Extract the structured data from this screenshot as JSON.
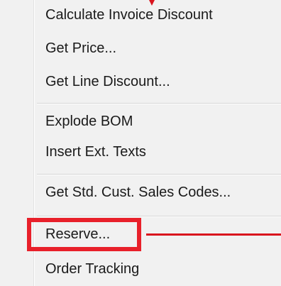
{
  "context_menu": {
    "items": [
      {
        "label": "Calculate Invoice Discount"
      },
      {
        "label": "Get Price..."
      },
      {
        "label": "Get Line Discount..."
      },
      {
        "label": "Explode BOM"
      },
      {
        "label": "Insert Ext. Texts"
      },
      {
        "label": "Get Std. Cust. Sales Codes..."
      },
      {
        "label": "Reserve..."
      },
      {
        "label": "Order Tracking"
      }
    ],
    "highlighted_item": "Reserve..."
  },
  "annotation": {
    "color": "#e8202a",
    "marker": "callout-arrow-icon"
  }
}
